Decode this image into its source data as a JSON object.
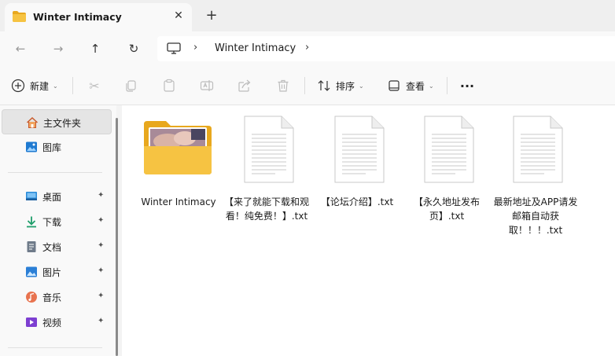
{
  "tab": {
    "title": "Winter Intimacy",
    "close_glyph": "✕",
    "new_tab_glyph": "+"
  },
  "nav": {
    "back": "←",
    "forward": "→",
    "up": "↑",
    "refresh": "↻",
    "sep": "›"
  },
  "address": {
    "crumbs": [
      "Winter Intimacy"
    ]
  },
  "toolbar": {
    "new_label": "新建",
    "sort_label": "排序",
    "view_label": "查看",
    "more_glyph": "···",
    "caret": "⌄"
  },
  "sidebar": {
    "items": [
      {
        "label": "主文件夹",
        "icon": "home-icon"
      },
      {
        "label": "图库",
        "icon": "gallery-icon"
      },
      {
        "label": "桌面",
        "icon": "desktop-icon"
      },
      {
        "label": "下载",
        "icon": "download-icon"
      },
      {
        "label": "文档",
        "icon": "document-icon"
      },
      {
        "label": "图片",
        "icon": "pictures-icon"
      },
      {
        "label": "音乐",
        "icon": "music-icon"
      },
      {
        "label": "视频",
        "icon": "video-icon"
      }
    ],
    "pin_glyph": "📌"
  },
  "files": [
    {
      "name": "Winter Intimacy",
      "type": "folder"
    },
    {
      "name": "【来了就能下载和观看！纯免费！】.txt",
      "type": "text"
    },
    {
      "name": "【论坛介绍】.txt",
      "type": "text"
    },
    {
      "name": "【永久地址发布页】.txt",
      "type": "text"
    },
    {
      "name": "最新地址及APP请发邮箱自动获取！！！.txt",
      "type": "text"
    }
  ],
  "colors": {
    "folder": "#f6c342",
    "folder_dark": "#e8a81e",
    "accent": "#0067c0"
  }
}
